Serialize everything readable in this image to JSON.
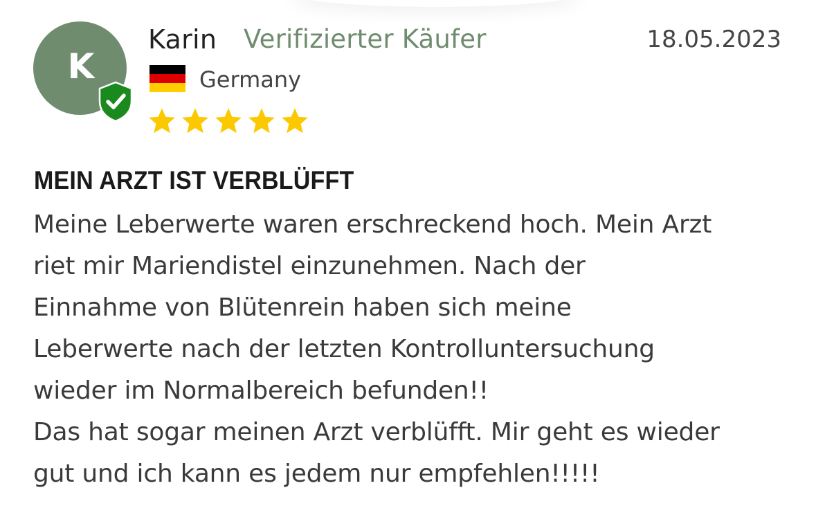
{
  "review": {
    "avatar_initial": "K",
    "reviewer_name": "Karin",
    "verified_label": "Verifizierter Käufer",
    "date": "18.05.2023",
    "country": "Germany",
    "rating": 5,
    "rating_max": 5,
    "title": "MEIN ARZT IST VERBLÜFFT",
    "body_lines": [
      "Meine Leberwerte waren erschreckend hoch. Mein Arzt",
      "riet mir Mariendistel einzunehmen. Nach der",
      "Einnahme von Blütenrein haben sich meine",
      "Leberwerte nach der letzten Kontrolluntersuchung",
      "wieder im Normalbereich befunden!!",
      "Das hat sogar meinen Arzt verblüfft. Mir geht es wieder",
      "gut und ich kann es jedem nur empfehlen!!!!!"
    ]
  },
  "icons": {
    "verified": "verified-shield-check-icon",
    "flag": "germany-flag-icon",
    "star": "star-icon"
  },
  "colors": {
    "avatar_bg": "#6f8c6f",
    "verified_text": "#6f8c6f",
    "shield": "#1a8a1f",
    "star": "#fcc900",
    "flag_black": "#000000",
    "flag_red": "#dd0000",
    "flag_gold": "#ffce00"
  }
}
